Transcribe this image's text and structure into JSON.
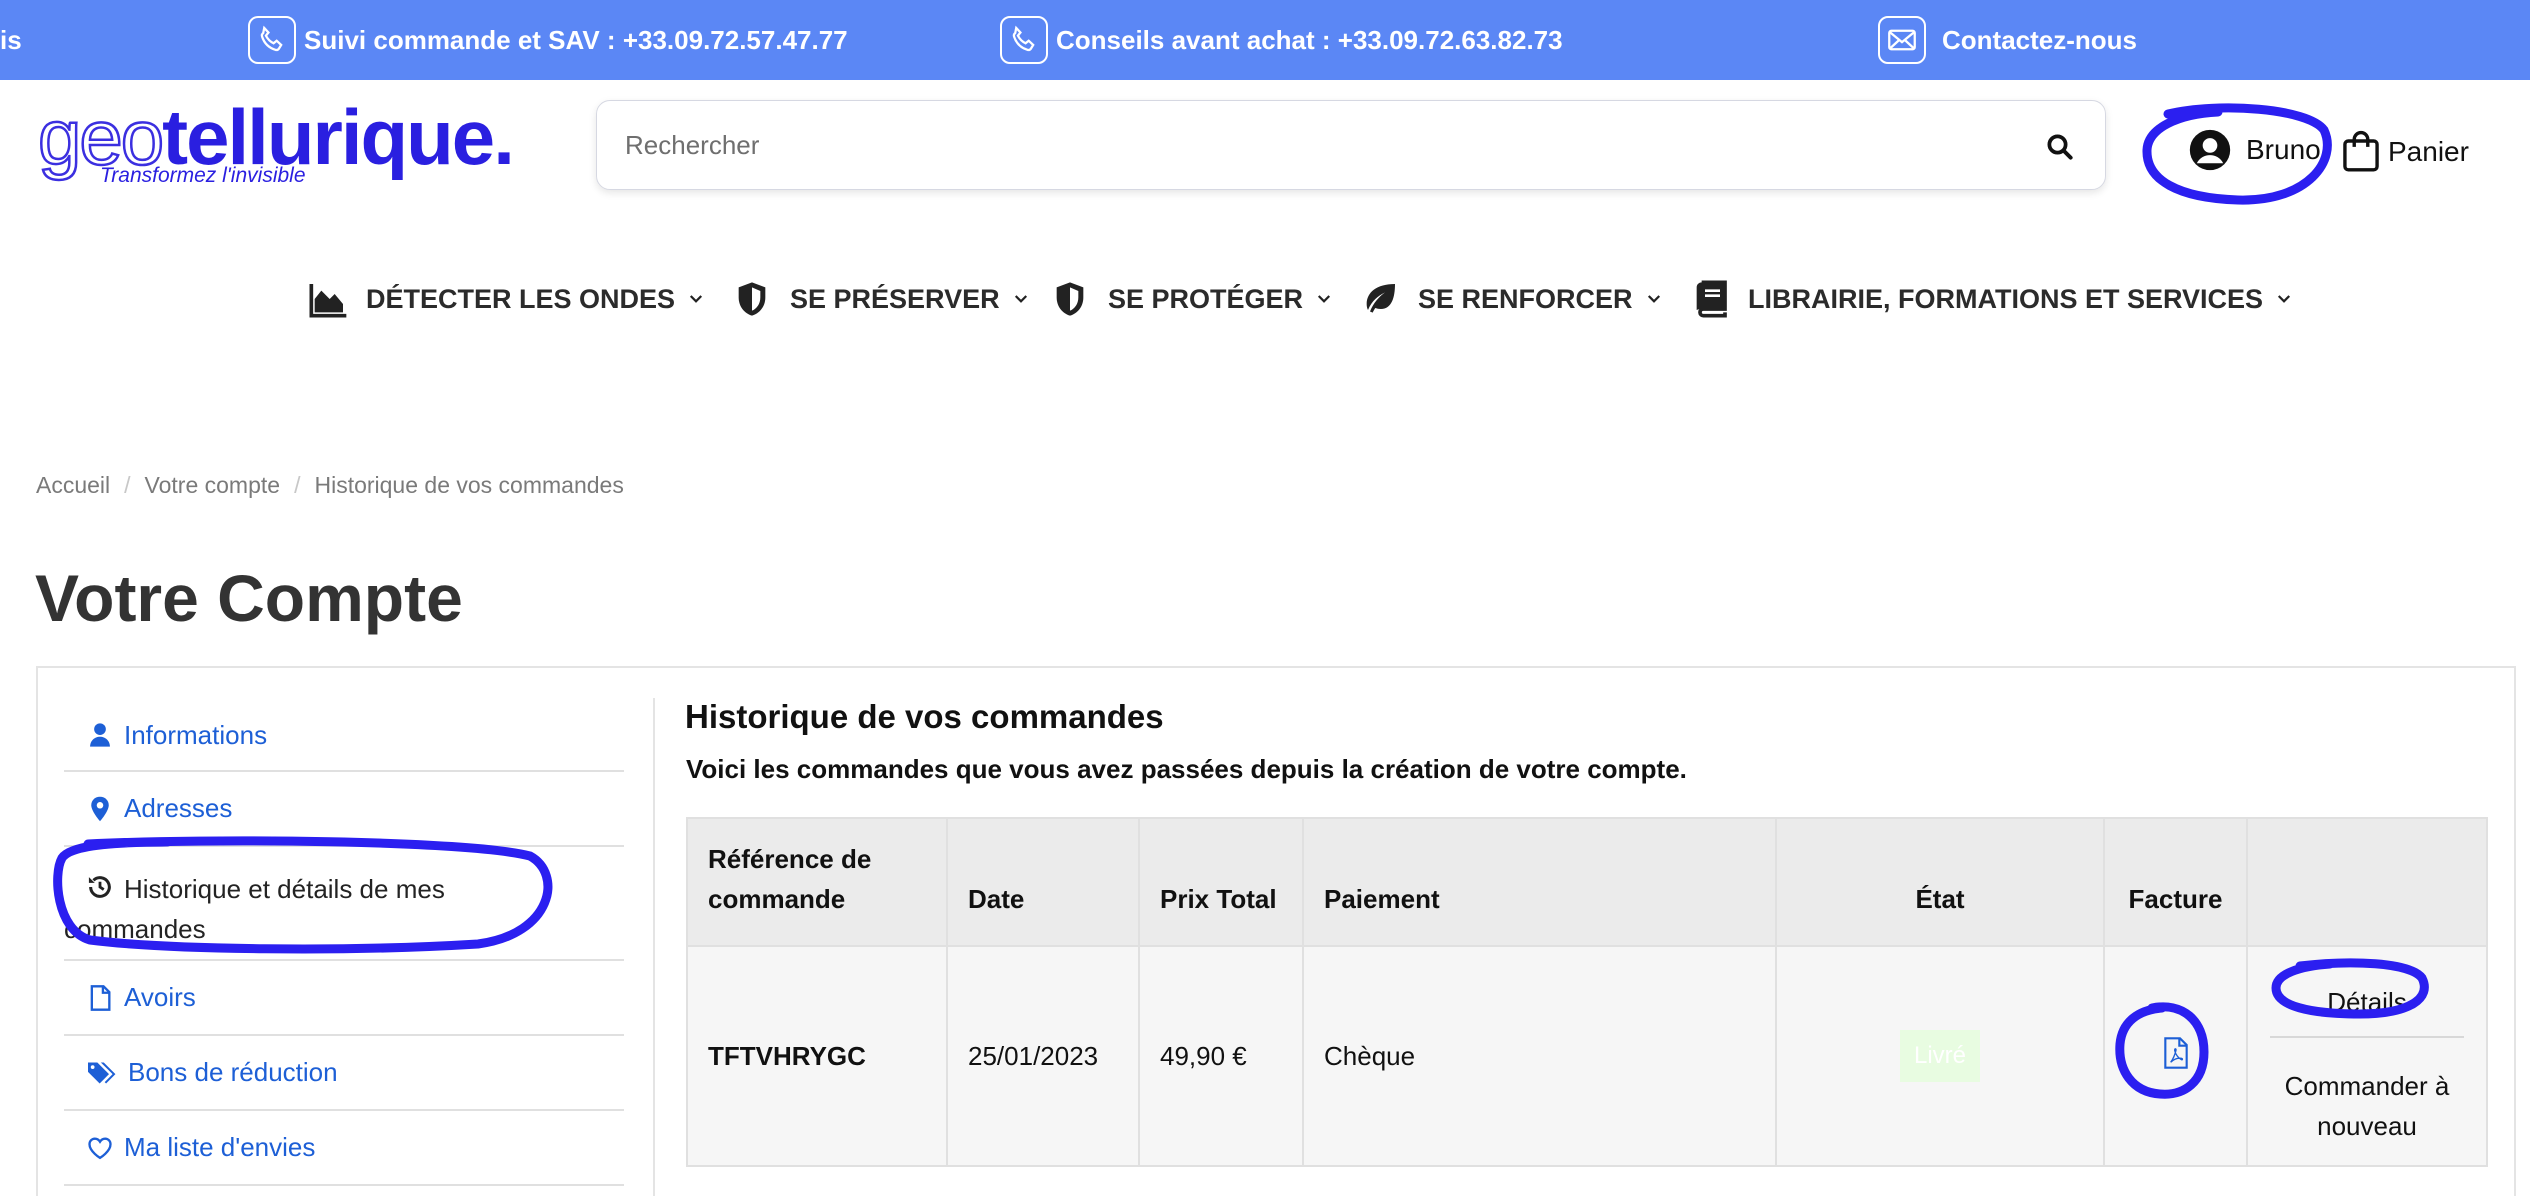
{
  "topbar": {
    "partial_left": "is",
    "support": "Suivi commande et SAV : +33.09.72.57.47.77",
    "advice": "Conseils avant achat : +33.09.72.63.82.73",
    "contact": "Contactez-nous"
  },
  "logo": {
    "part1": "geo",
    "part2": "tellurique",
    "dot": ".",
    "tagline": "Transformez l'invisible"
  },
  "search": {
    "placeholder": "Rechercher"
  },
  "header": {
    "user": "Bruno",
    "cart": "Panier"
  },
  "nav": [
    {
      "label": "DÉTECTER LES ONDES"
    },
    {
      "label": "SE PRÉSERVER"
    },
    {
      "label": "SE PROTÉGER"
    },
    {
      "label": "SE RENFORCER"
    },
    {
      "label": "LIBRAIRIE, FORMATIONS ET SERVICES"
    }
  ],
  "breadcrumb": [
    "Accueil",
    "Votre compte",
    "Historique de vos commandes"
  ],
  "page_title": "Votre Compte",
  "sidebar": [
    {
      "label": "Informations"
    },
    {
      "label": "Adresses"
    },
    {
      "label": "Historique et détails de mes commandes"
    },
    {
      "label": "Avoirs"
    },
    {
      "label": "Bons de réduction"
    },
    {
      "label": "Ma liste d'envies"
    }
  ],
  "orders": {
    "heading": "Historique de vos commandes",
    "intro": "Voici les commandes que vous avez passées depuis la création de votre compte.",
    "columns": [
      "Référence de commande",
      "Date",
      "Prix Total",
      "Paiement",
      "État",
      "Facture",
      ""
    ],
    "rows": [
      {
        "reference": "TFTVHRYGC",
        "date": "25/01/2023",
        "total": "49,90 €",
        "payment": "Chèque",
        "state": "Livré",
        "details": "Détails",
        "reorder": "Commander à nouveau"
      }
    ]
  },
  "colors": {
    "topbar": "#5b87f5",
    "brand": "#2a1fe0",
    "link": "#1d5fd6",
    "annotation": "#2b1ff0"
  }
}
